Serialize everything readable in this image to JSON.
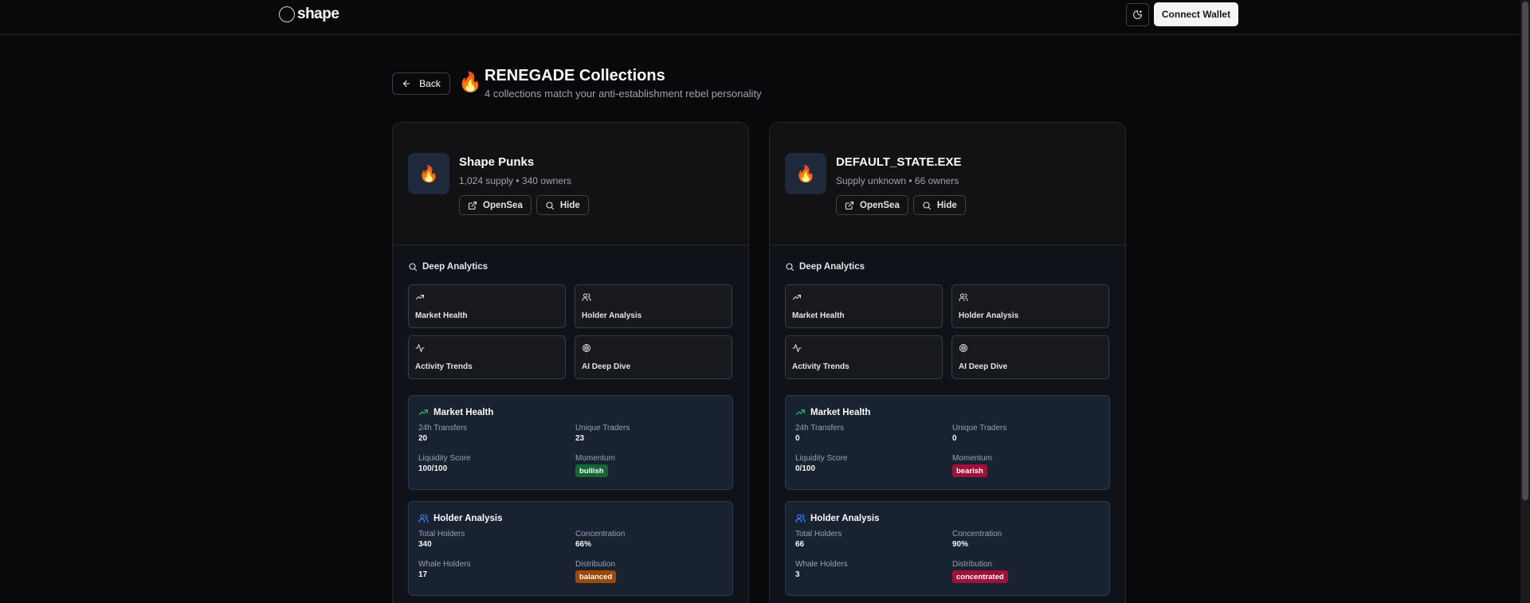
{
  "nav": {
    "logo_text": "shape",
    "connect_label": "Connect Wallet"
  },
  "header": {
    "back_label": "Back",
    "icon": "🔥",
    "title": "RENEGADE Collections",
    "subtitle": "4 collections match your anti-establishment rebel personality"
  },
  "labels": {
    "opensea": "OpenSea",
    "hide": "Hide",
    "deep_analytics": "Deep Analytics",
    "tile_market": "Market Health",
    "tile_holder": "Holder Analysis",
    "tile_activity": "Activity Trends",
    "tile_ai": "AI Deep Dive",
    "market_health": "Market Health",
    "holder_analysis": "Holder Analysis",
    "transfers_24h": "24h Transfers",
    "unique_traders": "Unique Traders",
    "liquidity_score": "Liquidity Score",
    "momentum": "Momentum",
    "total_holders": "Total Holders",
    "concentration": "Concentration",
    "whale_holders": "Whale Holders",
    "distribution": "Distribution"
  },
  "collections": [
    {
      "icon": "🔥",
      "name": "Shape Punks",
      "meta": "1,024 supply • 340 owners",
      "market": {
        "transfers_24h": "20",
        "unique_traders": "23",
        "liquidity_score": "100/100",
        "momentum": "bullish",
        "momentum_color": "#166534"
      },
      "holders": {
        "total_holders": "340",
        "concentration": "66%",
        "whale_holders": "17",
        "distribution": "balanced",
        "distribution_color": "#9a4a0a"
      }
    },
    {
      "icon": "🔥",
      "name": "DEFAULT_STATE.EXE",
      "meta": "Supply unknown • 66 owners",
      "market": {
        "transfers_24h": "0",
        "unique_traders": "0",
        "liquidity_score": "0/100",
        "momentum": "bearish",
        "momentum_color": "#9f1239"
      },
      "holders": {
        "total_holders": "66",
        "concentration": "90%",
        "whale_holders": "3",
        "distribution": "concentrated",
        "distribution_color": "#9f1239"
      }
    }
  ],
  "colors": {
    "market_icon": "#22c55e",
    "holder_icon": "#3b82f6"
  }
}
